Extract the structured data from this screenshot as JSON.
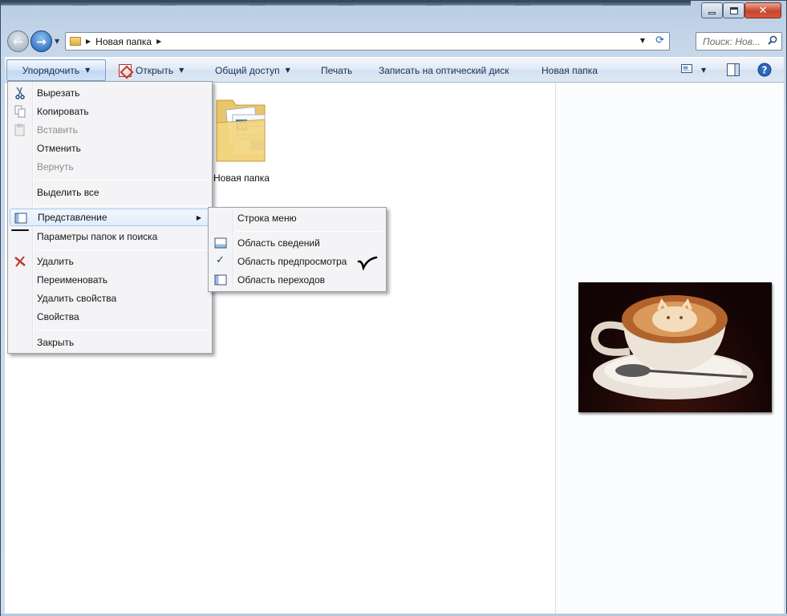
{
  "window": {
    "controls": {
      "minimize": "minimize-icon",
      "maximize": "maximize-icon",
      "close": "close-icon"
    }
  },
  "address_bar": {
    "breadcrumb": [
      "Новая папка"
    ],
    "search_placeholder": "Поиск: Нов..."
  },
  "toolbar": {
    "organize": "Упорядочить",
    "open": "Открыть",
    "share": "Общий доступ",
    "print": "Печать",
    "burn": "Записать на оптический диск",
    "new_folder": "Новая папка"
  },
  "content": {
    "items": [
      {
        "name": "Новая папка",
        "icon": "folder-icon"
      }
    ]
  },
  "organize_menu": {
    "items": [
      {
        "label": "Вырезать",
        "icon": "scissors-icon",
        "enabled": true
      },
      {
        "label": "Копировать",
        "icon": "copy-icon",
        "enabled": true
      },
      {
        "label": "Вставить",
        "icon": "paste-icon",
        "enabled": false
      },
      {
        "label": "Отменить",
        "enabled": true
      },
      {
        "label": "Вернуть",
        "enabled": false
      },
      {
        "label": "Выделить все",
        "enabled": true
      },
      {
        "label": "Представление",
        "icon": "layout-icon",
        "enabled": true,
        "submenu": true
      },
      {
        "label": "Параметры папок и поиска",
        "enabled": true
      },
      {
        "label": "Удалить",
        "icon": "delete-icon",
        "enabled": true
      },
      {
        "label": "Переименовать",
        "enabled": true
      },
      {
        "label": "Удалить свойства",
        "enabled": true
      },
      {
        "label": "Свойства",
        "enabled": true
      },
      {
        "label": "Закрыть",
        "enabled": true
      }
    ]
  },
  "layout_submenu": {
    "items": [
      {
        "label": "Строка меню",
        "checked": false
      },
      {
        "label": "Область сведений",
        "icon": "details-pane-icon",
        "checked": false
      },
      {
        "label": "Область предпросмотра",
        "checked": true
      },
      {
        "label": "Область переходов",
        "icon": "navigation-pane-icon",
        "checked": false
      }
    ]
  },
  "colors": {
    "accent": "#1d5fb0",
    "menu_highlight": "#e2edfb",
    "delete_red": "#c0392b"
  }
}
